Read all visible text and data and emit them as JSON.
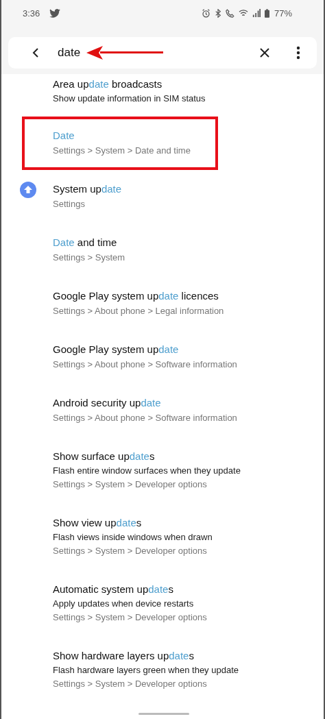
{
  "status_bar": {
    "time": "3:36",
    "battery": "77%"
  },
  "search": {
    "value": "date",
    "pointer_arrow": true
  },
  "results": [
    {
      "title": [
        {
          "text": "Area up",
          "match": false
        },
        {
          "text": "date",
          "match": true
        },
        {
          "text": " broadcasts",
          "match": false
        }
      ],
      "description": "Show update information in SIM status",
      "highlighted": false
    },
    {
      "title": [
        {
          "text": "Date",
          "match": true
        }
      ],
      "path": "Settings > System > Date and time",
      "highlighted": true
    },
    {
      "title": [
        {
          "text": "System up",
          "match": false
        },
        {
          "text": "date",
          "match": true
        }
      ],
      "path": "Settings",
      "highlighted": false,
      "kind": "update"
    },
    {
      "title": [
        {
          "text": "Date",
          "match": true
        },
        {
          "text": " and time",
          "match": false
        }
      ],
      "path": "Settings > System",
      "highlighted": false
    },
    {
      "title": [
        {
          "text": "Google Play system up",
          "match": false
        },
        {
          "text": "date",
          "match": true
        },
        {
          "text": " licences",
          "match": false
        }
      ],
      "path": "Settings > About phone > Legal information",
      "highlighted": false
    },
    {
      "title": [
        {
          "text": "Google Play system up",
          "match": false
        },
        {
          "text": "date",
          "match": true
        }
      ],
      "path": "Settings > About phone > Software information",
      "highlighted": false
    },
    {
      "title": [
        {
          "text": "Android security up",
          "match": false
        },
        {
          "text": "date",
          "match": true
        }
      ],
      "path": "Settings > About phone > Software information",
      "highlighted": false
    },
    {
      "title": [
        {
          "text": "Show surface up",
          "match": false
        },
        {
          "text": "date",
          "match": true
        },
        {
          "text": "s",
          "match": false
        }
      ],
      "description": "Flash entire window surfaces when they update",
      "path": "Settings > System > Developer options",
      "highlighted": false
    },
    {
      "title": [
        {
          "text": "Show view up",
          "match": false
        },
        {
          "text": "date",
          "match": true
        },
        {
          "text": "s",
          "match": false
        }
      ],
      "description": "Flash views inside windows when drawn",
      "path": "Settings > System > Developer options",
      "highlighted": false
    },
    {
      "title": [
        {
          "text": "Automatic system up",
          "match": false
        },
        {
          "text": "date",
          "match": true
        },
        {
          "text": "s",
          "match": false
        }
      ],
      "description": "Apply updates when device restarts",
      "path": "Settings > System > Developer options",
      "highlighted": false
    },
    {
      "title": [
        {
          "text": "Show hardware layers up",
          "match": false
        },
        {
          "text": "date",
          "match": true
        },
        {
          "text": "s",
          "match": false
        }
      ],
      "description": "Flash hardware layers green when they update",
      "path": "Settings > System > Developer options",
      "highlighted": false
    }
  ]
}
